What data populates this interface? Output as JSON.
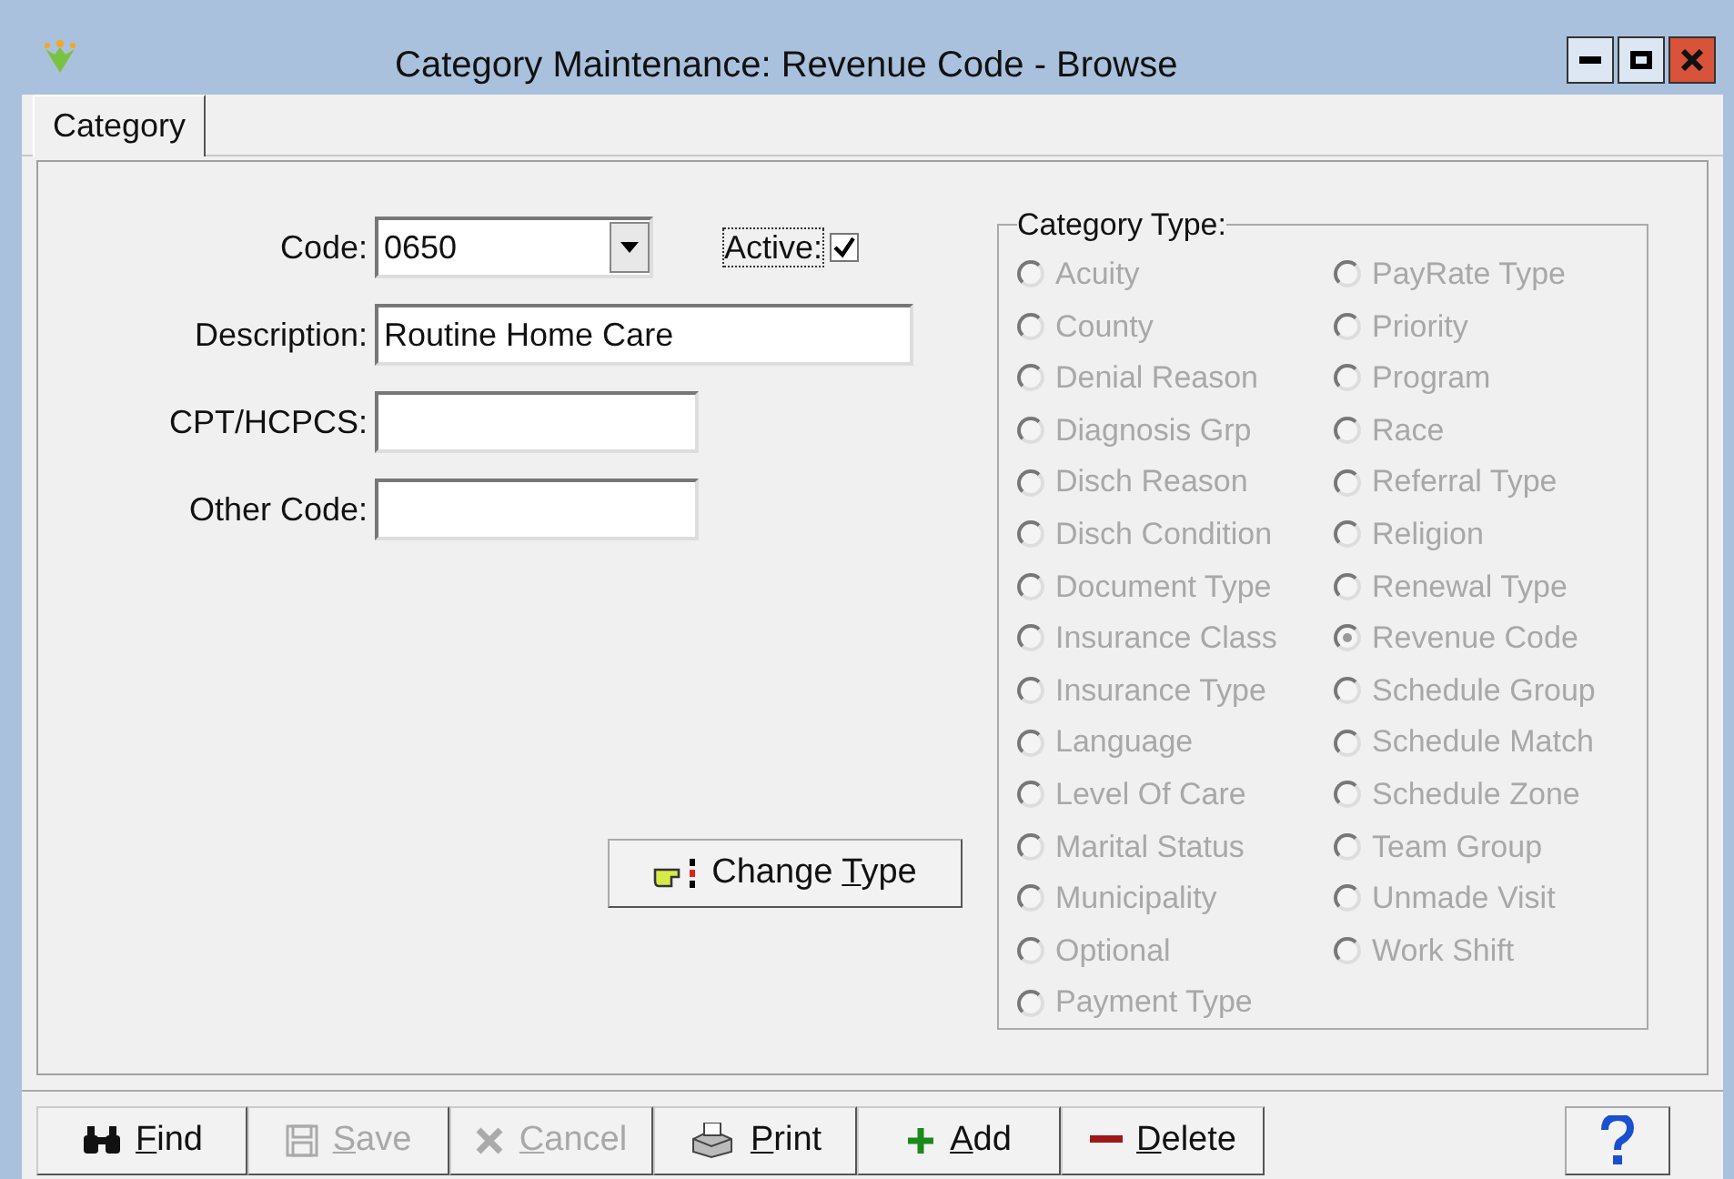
{
  "window": {
    "title": "Category Maintenance: Revenue Code - Browse"
  },
  "tabs": [
    {
      "label": "Category",
      "selected": true
    }
  ],
  "form": {
    "code": {
      "label": "Code:",
      "value": "0650"
    },
    "active": {
      "label": "Active:",
      "checked": true
    },
    "description": {
      "label": "Description:",
      "value": "Routine Home Care"
    },
    "cpt_hcpcs": {
      "label": "CPT/HCPCS:"
    },
    "other_code": {
      "label": "Other Code:"
    },
    "change_type": {
      "before": "Change ",
      "hotkey": "T",
      "after": "ype"
    }
  },
  "category_type": {
    "title": "Category Type:",
    "disabled": true,
    "columns": [
      [
        {
          "label": "Acuity",
          "selected": false
        },
        {
          "label": "County",
          "selected": false
        },
        {
          "label": "Denial Reason",
          "selected": false
        },
        {
          "label": "Diagnosis Grp",
          "selected": false
        },
        {
          "label": "Disch Reason",
          "selected": false
        },
        {
          "label": "Disch Condition",
          "selected": false
        },
        {
          "label": "Document Type",
          "selected": false
        },
        {
          "label": "Insurance Class",
          "selected": false
        },
        {
          "label": "Insurance Type",
          "selected": false
        },
        {
          "label": "Language",
          "selected": false
        },
        {
          "label": "Level Of Care",
          "selected": false
        },
        {
          "label": "Marital Status",
          "selected": false
        },
        {
          "label": "Municipality",
          "selected": false
        },
        {
          "label": "Optional",
          "selected": false
        },
        {
          "label": "Payment Type",
          "selected": false
        }
      ],
      [
        {
          "label": "PayRate Type",
          "selected": false
        },
        {
          "label": "Priority",
          "selected": false
        },
        {
          "label": "Program",
          "selected": false
        },
        {
          "label": "Race",
          "selected": false
        },
        {
          "label": "Referral Type",
          "selected": false
        },
        {
          "label": "Religion",
          "selected": false
        },
        {
          "label": "Renewal Type",
          "selected": false
        },
        {
          "label": "Revenue Code",
          "selected": true
        },
        {
          "label": "Schedule Group",
          "selected": false
        },
        {
          "label": "Schedule Match",
          "selected": false
        },
        {
          "label": "Schedule Zone",
          "selected": false
        },
        {
          "label": "Team Group",
          "selected": false
        },
        {
          "label": "Unmade Visit",
          "selected": false
        },
        {
          "label": "Work Shift",
          "selected": false
        }
      ]
    ]
  },
  "toolbar": [
    {
      "kind": "find",
      "hotkey": "F",
      "after": "ind",
      "disabled": false
    },
    {
      "kind": "save",
      "hotkey": "S",
      "after": "ave",
      "disabled": true
    },
    {
      "kind": "cancel",
      "hotkey": "C",
      "after": "ancel",
      "disabled": true
    },
    {
      "kind": "print",
      "hotkey": "P",
      "after": "rint",
      "disabled": false
    },
    {
      "kind": "add",
      "hotkey": "A",
      "after": "dd",
      "disabled": false
    },
    {
      "kind": "delete",
      "hotkey": "D",
      "after": "elete",
      "disabled": false
    }
  ]
}
